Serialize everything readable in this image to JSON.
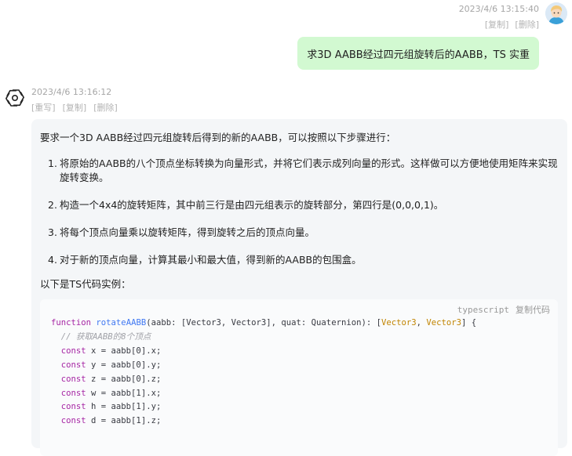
{
  "user_message": {
    "timestamp": "2023/4/6 13:15:40",
    "actions": [
      "[复制]",
      "[删除]"
    ],
    "text": "求3D AABB经过四元组旋转后的AABB，TS 实重"
  },
  "assistant_message": {
    "timestamp": "2023/4/6 13:16:12",
    "actions": [
      "[重写]",
      "[复制]",
      "[删除]"
    ],
    "intro": "要求一个3D AABB经过四元组旋转后得到的新的AABB，可以按照以下步骤进行：",
    "steps": [
      {
        "num": "1.",
        "text": "将原始的AABB的八个顶点坐标转换为向量形式，并将它们表示成列向量的形式。这样做可以方便地使用矩阵来实现旋转变换。"
      },
      {
        "num": "2.",
        "text": "构造一个4x4的旋转矩阵，其中前三行是由四元组表示的旋转部分，第四行是(0,0,0,1)。"
      },
      {
        "num": "3.",
        "text": "将每个顶点向量乘以旋转矩阵，得到旋转之后的顶点向量。"
      },
      {
        "num": "4.",
        "text": "对于新的顶点向量，计算其最小和最大值，得到新的AABB的包围盒。"
      }
    ],
    "code_lead": "以下是TS代码实例：",
    "code": {
      "language": "typescript",
      "copy_label": "复制代码",
      "lines": [
        "function rotateAABB(aabb: [Vector3, Vector3], quat: Quaternion): [Vector3, Vector3] {",
        "  // 获取AABB的8个顶点",
        "  const x = aabb[0].x;",
        "  const y = aabb[0].y;",
        "  const z = aabb[0].z;",
        "  const w = aabb[1].x;",
        "  const h = aabb[1].y;",
        "  const d = aabb[1].z;"
      ]
    }
  }
}
